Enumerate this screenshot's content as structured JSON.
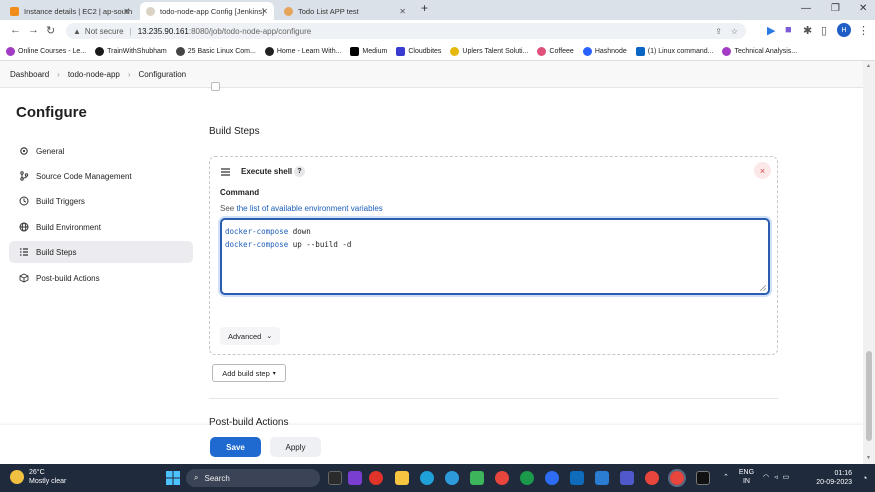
{
  "browser": {
    "tabs": [
      {
        "label": "Instance details | EC2 | ap-south",
        "color": "#f08c1a",
        "active": false
      },
      {
        "label": "todo-node-app Config [Jenkins]",
        "color": "#ffffff",
        "active": true
      },
      {
        "label": "Todo List APP test",
        "color": "#e6a35a",
        "active": false
      }
    ],
    "new_tab_glyph": "+",
    "security_label": "Not secure",
    "url_host": "13.235.90.161",
    "url_path": ":8080/job/todo-node-app/configure",
    "profile_initial": "H",
    "bookmarks": [
      {
        "label": "Online Courses - Le...",
        "color": "#a33bc4"
      },
      {
        "label": "TrainWithShubham",
        "color": "#1a1a1a"
      },
      {
        "label": "25 Basic Linux Com...",
        "color": "#444444"
      },
      {
        "label": "Home - Learn With...",
        "color": "#222222"
      },
      {
        "label": "Medium",
        "color": "#000000"
      },
      {
        "label": "Cloudbites",
        "color": "#3a3ad0"
      },
      {
        "label": "Uplers Talent Soluti...",
        "color": "#e5b80b"
      },
      {
        "label": "Coffeee",
        "color": "#e0507a"
      },
      {
        "label": "Hashnode",
        "color": "#2962ff"
      },
      {
        "label": "(1) Linux command...",
        "color": "#0a66c2"
      },
      {
        "label": "Technical Analysis...",
        "color": "#a33bc4"
      }
    ]
  },
  "breadcrumb": [
    "Dashboard",
    "todo-node-app",
    "Configuration"
  ],
  "sidebar": {
    "title": "Configure",
    "items": [
      {
        "label": "General",
        "icon": "gear-icon",
        "active": false
      },
      {
        "label": "Source Code Management",
        "icon": "branch-icon",
        "active": false
      },
      {
        "label": "Build Triggers",
        "icon": "clock-icon",
        "active": false
      },
      {
        "label": "Build Environment",
        "icon": "globe-icon",
        "active": false
      },
      {
        "label": "Build Steps",
        "icon": "list-icon",
        "active": true
      },
      {
        "label": "Post-build Actions",
        "icon": "cube-icon",
        "active": false
      }
    ]
  },
  "main": {
    "section_title": "Build Steps",
    "step": {
      "title": "Execute shell",
      "help": "?",
      "delete_glyph": "×",
      "command_label": "Command",
      "env_prefix": "See ",
      "env_link": "the list of available environment variables",
      "command_lines": [
        {
          "cmd": "docker-compose",
          "args": " down"
        },
        {
          "cmd": "docker-compose",
          "args": " up --build -d"
        }
      ],
      "advanced_label": "Advanced"
    },
    "add_build_step_label": "Add build step",
    "post_build_title": "Post-build Actions",
    "save_label": "Save",
    "apply_label": "Apply"
  },
  "taskbar": {
    "weather_temp": "26°C",
    "weather_desc": "Mostly clear",
    "search_label": "Search",
    "language_line1": "ENG",
    "language_line2": "IN",
    "time": "01:16",
    "date": "20-09-2023"
  },
  "colors": {
    "accent": "#1f6ad1",
    "link": "#1d5fb8",
    "taskbar": "#1f2a3d"
  }
}
